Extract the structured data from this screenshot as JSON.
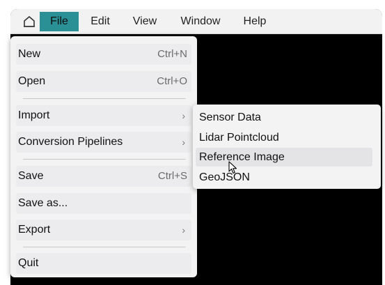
{
  "menubar": {
    "menus": [
      "File",
      "Edit",
      "View",
      "Window",
      "Help"
    ],
    "active_menu": "File",
    "active_color": "#2b8f96"
  },
  "home_icon": "home-icon",
  "file_menu": {
    "items": [
      {
        "label": "New",
        "shortcut": "Ctrl+N"
      },
      {
        "label": "Open",
        "shortcut": "Ctrl+O"
      },
      {
        "label": "Import",
        "submenu": true
      },
      {
        "label": "Conversion Pipelines",
        "submenu": true
      },
      {
        "label": "Save",
        "shortcut": "Ctrl+S"
      },
      {
        "label": "Save as..."
      },
      {
        "label": "Export",
        "submenu": true
      },
      {
        "label": "Quit"
      }
    ],
    "submenu_arrow": "›"
  },
  "import_submenu": {
    "items": [
      "Sensor Data",
      "Lidar Pointcloud",
      "Reference Image",
      "GeoJSON"
    ],
    "hovered_item": "Reference Image"
  },
  "cursor_icon": "mouse-pointer-icon"
}
